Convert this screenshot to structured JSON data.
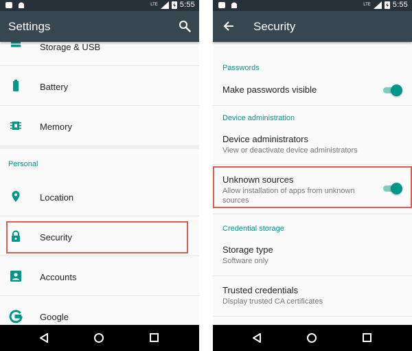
{
  "left": {
    "status": {
      "network": "LTE",
      "time": "5:55"
    },
    "appbar": {
      "title": "Settings",
      "search_icon": "search-icon"
    },
    "items_top": [
      {
        "label": "Storage & USB",
        "icon": "storage-icon"
      },
      {
        "label": "Battery",
        "icon": "battery-icon"
      },
      {
        "label": "Memory",
        "icon": "memory-icon"
      }
    ],
    "section": "Personal",
    "items_personal": [
      {
        "label": "Location",
        "icon": "location-icon"
      },
      {
        "label": "Security",
        "icon": "lock-icon"
      },
      {
        "label": "Accounts",
        "icon": "account-icon"
      },
      {
        "label": "Google",
        "icon": "google-icon"
      }
    ]
  },
  "right": {
    "status": {
      "network": "LTE",
      "time": "5:55"
    },
    "appbar": {
      "title": "Security",
      "back_icon": "back-arrow-icon"
    },
    "passwords": {
      "header": "Passwords",
      "make_visible": {
        "title": "Make passwords visible",
        "enabled": true
      }
    },
    "device_admin": {
      "header": "Device administration",
      "administrators": {
        "title": "Device administrators",
        "summary": "View or deactivate device administrators"
      },
      "unknown_sources": {
        "title": "Unknown sources",
        "summary": "Allow installation of apps from unknown sources",
        "enabled": true
      }
    },
    "credential": {
      "header": "Credential storage",
      "storage_type": {
        "title": "Storage type",
        "summary": "Software only"
      },
      "trusted": {
        "title": "Trusted credentials",
        "summary": "Display trusted CA certificates"
      }
    }
  },
  "colors": {
    "accent": "#009688",
    "appbar": "#37474f",
    "statusbar": "#263238",
    "highlight": "#e05a4f"
  }
}
